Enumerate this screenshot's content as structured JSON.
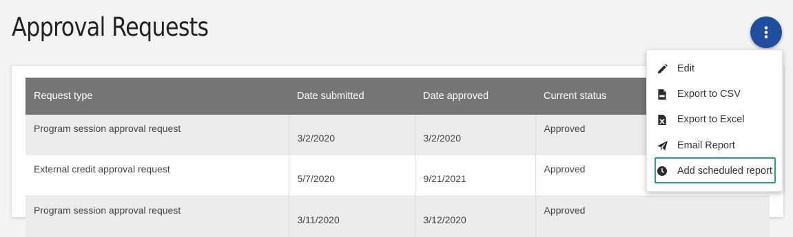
{
  "header": {
    "title": "Approval Requests"
  },
  "actions_button": {
    "icon": "more-vertical-icon",
    "color": "#1f4ea0"
  },
  "table": {
    "columns": [
      "Request type",
      "Date submitted",
      "Date approved",
      "Current status"
    ],
    "rows": [
      {
        "type": "Program session approval request",
        "submitted": "3/2/2020",
        "approved": "3/2/2020",
        "status": "Approved"
      },
      {
        "type": "External credit approval request",
        "submitted": "5/7/2020",
        "approved": "9/21/2021",
        "status": "Approved"
      },
      {
        "type": "Program session approval request",
        "submitted": "3/11/2020",
        "approved": "3/12/2020",
        "status": "Approved"
      }
    ]
  },
  "menu": {
    "items": [
      {
        "label": "Edit",
        "icon": "pencil-icon"
      },
      {
        "label": "Export to CSV",
        "icon": "csv-file-icon"
      },
      {
        "label": "Export to Excel",
        "icon": "excel-file-icon"
      },
      {
        "label": "Email Report",
        "icon": "paper-plane-icon"
      },
      {
        "label": "Add scheduled report",
        "icon": "clock-icon"
      }
    ],
    "highlight_color": "#2e9e86"
  }
}
